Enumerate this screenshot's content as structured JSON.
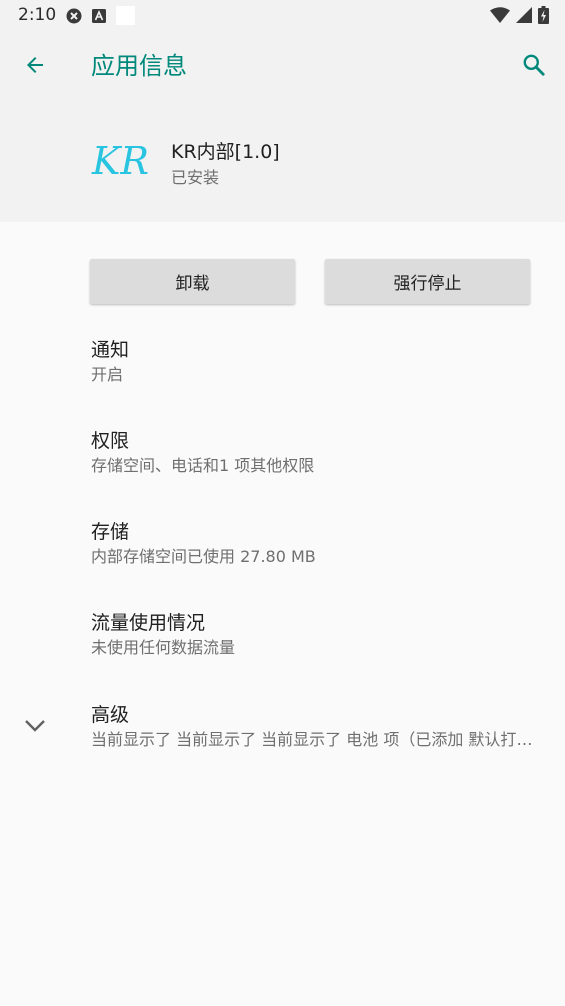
{
  "status_bar": {
    "time": "2:10",
    "icons_left": [
      "close-circle-icon",
      "a-badge-icon",
      "white-square-icon"
    ],
    "icons_right": [
      "wifi-icon",
      "signal-icon",
      "battery-charging-icon"
    ]
  },
  "header": {
    "title": "应用信息",
    "back_icon": "arrow-left-icon",
    "search_icon": "search-icon"
  },
  "app": {
    "icon_text": "KR",
    "name": "KR内部[1.0]",
    "status": "已安装"
  },
  "buttons": {
    "uninstall": "卸载",
    "force_stop": "强行停止"
  },
  "items": [
    {
      "title": "通知",
      "subtitle": "开启"
    },
    {
      "title": "权限",
      "subtitle": "存储空间、电话和1 项其他权限"
    },
    {
      "title": "存储",
      "subtitle": "内部存储空间已使用 27.80 MB"
    },
    {
      "title": "流量使用情况",
      "subtitle": "未使用任何数据流量"
    },
    {
      "title": "高级",
      "subtitle": "当前显示了 当前显示了 当前显示了 电池 项（已添加 默认打开、商店"
    }
  ],
  "colors": {
    "accent": "#00897b",
    "header_bg": "#f2f2f2",
    "body_bg": "#fafafa",
    "button_bg": "#dcdcdc",
    "logo": "#29c4e0"
  }
}
